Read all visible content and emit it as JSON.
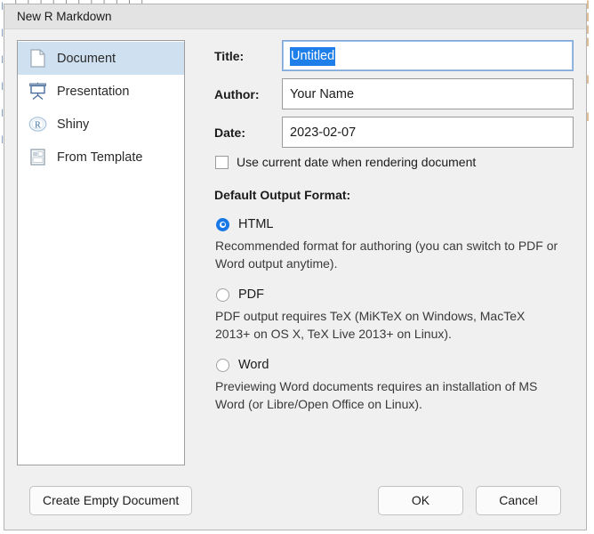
{
  "backdrop": {
    "top_strip_text": "l   l  l  l   l     l           l l    l    l  l      l",
    "right_column_text": "|\n|\n|\n|\n \n \n|\n \n \n|\n \n \n \n \n ",
    "left_column_text": "|\n \n|\n \n|\n \n|\n \n|\n \n|\n \n \n \n "
  },
  "dialog": {
    "title": "New R Markdown"
  },
  "sidebar": {
    "items": [
      {
        "label": "Document",
        "icon": "document-icon",
        "selected": true
      },
      {
        "label": "Presentation",
        "icon": "presentation-icon",
        "selected": false
      },
      {
        "label": "Shiny",
        "icon": "shiny-r-logo-icon",
        "selected": false
      },
      {
        "label": "From Template",
        "icon": "template-icon",
        "selected": false
      }
    ]
  },
  "form": {
    "title_label": "Title:",
    "title_value": "Untitled",
    "title_selected": true,
    "author_label": "Author:",
    "author_value": "Your Name",
    "date_label": "Date:",
    "date_value": "2023-02-07",
    "use_current_date_label": "Use current date when rendering document",
    "use_current_date_checked": false,
    "output_format_heading": "Default Output Format:",
    "formats": [
      {
        "label": "HTML",
        "checked": true,
        "description": "Recommended format for authoring (you can switch to PDF or Word output anytime)."
      },
      {
        "label": "PDF",
        "checked": false,
        "description": "PDF output requires TeX (MiKTeX on Windows, MacTeX 2013+ on OS X, TeX Live 2013+ on Linux)."
      },
      {
        "label": "Word",
        "checked": false,
        "description": "Previewing Word documents requires an installation of MS Word (or Libre/Open Office on Linux)."
      }
    ]
  },
  "footer": {
    "create_empty_label": "Create Empty Document",
    "ok_label": "OK",
    "cancel_label": "Cancel"
  },
  "colors": {
    "accent_blue": "#1878e6",
    "selection_blue": "#1f7fea",
    "sidebar_selected": "#cfe0f0",
    "dialog_bg": "#f0f0f0",
    "titlebar_bg": "#e3e3e3"
  }
}
